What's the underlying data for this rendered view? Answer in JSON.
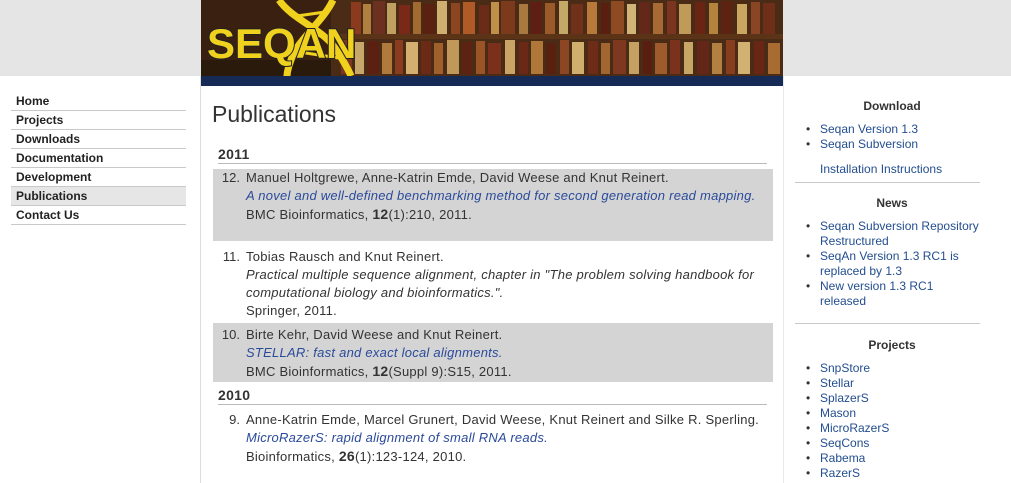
{
  "logo_text": "SEQAN",
  "nav": [
    "Home",
    "Projects",
    "Downloads",
    "Documentation",
    "Development",
    "Publications",
    "Contact Us"
  ],
  "page_title": "Publications",
  "years": [
    "2011",
    "2010"
  ],
  "pubs": [
    {
      "num": "12.",
      "authors": "Manuel Holtgrewe, Anne-Katrin Emde, David Weese and Knut Reinert.",
      "title": "A novel and well-defined benchmarking method for second generation read mapping.",
      "journal": "BMC Bioinformatics, ",
      "vol": "12",
      "rest": "(1):210, 2011."
    },
    {
      "num": "11.",
      "authors": "Tobias Rausch and Knut Reinert.",
      "title": "Practical multiple sequence alignment, chapter in \"The problem solving handbook for computational biology and bioinformatics.\".",
      "journal": "Springer, 2011."
    },
    {
      "num": "10.",
      "authors": "Birte Kehr, David Weese and Knut Reinert.",
      "title": "STELLAR: fast and exact local alignments.",
      "journal": "BMC Bioinformatics, ",
      "vol": "12",
      "rest": "(Suppl 9):S15, 2011."
    },
    {
      "num": "9.",
      "authors": "Anne-Katrin Emde, Marcel Grunert, David Weese, Knut Reinert and Silke R. Sperling.",
      "title": "MicroRazerS: rapid alignment of small RNA reads.",
      "journal": "Bioinformatics, ",
      "vol": "26",
      "rest": "(1):123-124, 2010."
    }
  ],
  "download": {
    "title": "Download",
    "items": [
      "Seqan Version 1.3",
      "Seqan Subversion"
    ],
    "install": "Installation Instructions"
  },
  "news": {
    "title": "News",
    "items": [
      "Seqan Subversion Repository Restructured",
      "SeqAn Version 1.3 RC1 is replaced by 1.3",
      "New version 1.3 RC1 released"
    ]
  },
  "projects": {
    "title": "Projects",
    "items": [
      "SnpStore",
      "Stellar",
      "SplazerS",
      "Mason",
      "MicroRazerS",
      "SeqCons",
      "Rabema",
      "RazerS"
    ]
  },
  "colors": {
    "link": "#234e8f",
    "pub_title": "#2a4a9a",
    "logo_yellow": "#f0d21e",
    "band": "#152a55"
  }
}
